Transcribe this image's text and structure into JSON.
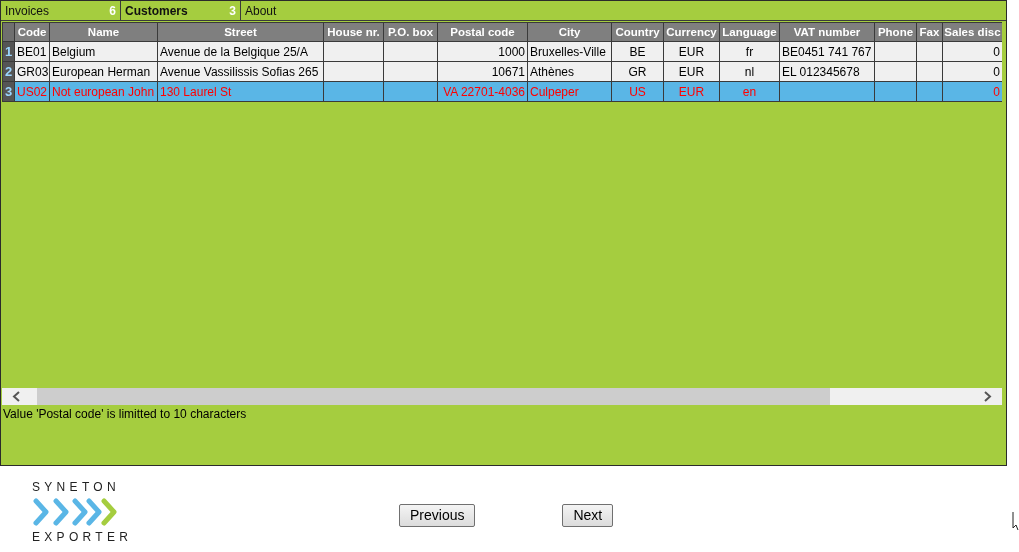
{
  "tabs": [
    {
      "label": "Invoices",
      "count": "6",
      "selected": false
    },
    {
      "label": "Customers",
      "count": "3",
      "selected": true
    },
    {
      "label": "About",
      "selected": false
    }
  ],
  "table": {
    "columns": [
      "Code",
      "Name",
      "Street",
      "House nr.",
      "P.O. box",
      "Postal code",
      "City",
      "Country",
      "Currency",
      "Language",
      "VAT number",
      "Phone",
      "Fax",
      "Sales disc"
    ],
    "rows": [
      {
        "number": "1",
        "selected": false,
        "error": false,
        "cells": [
          "BE01",
          "Belgium",
          "Avenue de la Belgique 25/A",
          null,
          null,
          "1000",
          "Bruxelles-Ville",
          "BE",
          "EUR",
          "fr",
          "BE0451 741 767",
          null,
          null,
          "0"
        ]
      },
      {
        "number": "2",
        "selected": false,
        "error": false,
        "cells": [
          "GR03",
          "European Herman",
          "Avenue Vassilissis Sofias 265",
          null,
          null,
          "10671",
          "Athènes",
          "GR",
          "EUR",
          "nl",
          "EL 012345678",
          null,
          null,
          "0"
        ]
      },
      {
        "number": "3",
        "selected": true,
        "error": true,
        "cells": [
          "US02",
          "Not european John",
          "130 Laurel St",
          null,
          null,
          "VA 22701-4036",
          "Culpeper",
          "US",
          "EUR",
          "en",
          null,
          null,
          null,
          "0"
        ]
      }
    ]
  },
  "status_message": "Value 'Postal code' is limitted to 10 characters",
  "logo": {
    "top_text": "SYNETON",
    "bottom_text": "EXPORTER"
  },
  "buttons": [
    {
      "label": "Previous"
    },
    {
      "label": "Next"
    }
  ]
}
